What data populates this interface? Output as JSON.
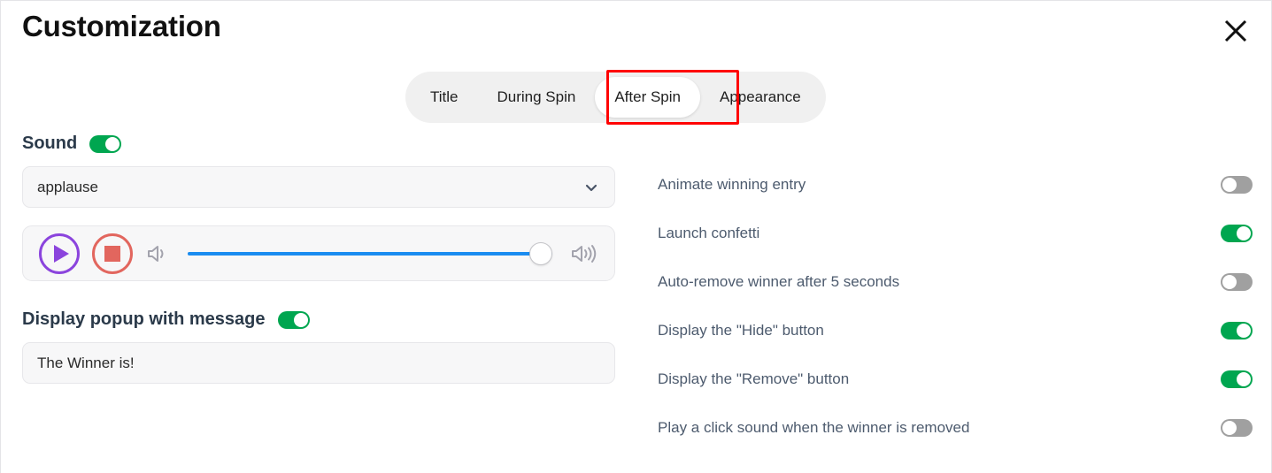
{
  "dialog": {
    "title": "Customization",
    "close_icon": "close-icon"
  },
  "tabs": {
    "items": [
      {
        "label": "Title",
        "active": false
      },
      {
        "label": "During Spin",
        "active": false
      },
      {
        "label": "After Spin",
        "active": true
      },
      {
        "label": "Appearance",
        "active": false
      }
    ],
    "highlight_color": "#ff0000",
    "active_index": 2
  },
  "sound": {
    "label": "Sound",
    "enabled": true,
    "select_value": "applause",
    "chevron_icon": "chevron-down-icon",
    "player": {
      "play_icon": "play-icon",
      "stop_icon": "stop-icon",
      "volume_low_icon": "volume-low-icon",
      "volume_high_icon": "volume-high-icon",
      "volume_percent": 100
    }
  },
  "popup": {
    "label": "Display popup with message",
    "enabled": true,
    "message": "The Winner is!"
  },
  "options": [
    {
      "label": "Animate winning entry",
      "on": false
    },
    {
      "label": "Launch confetti",
      "on": true
    },
    {
      "label": "Auto-remove winner after 5 seconds",
      "on": false
    },
    {
      "label": "Display the \"Hide\" button",
      "on": true
    },
    {
      "label": "Display the \"Remove\" button",
      "on": true
    },
    {
      "label": "Play a click sound when the winner is removed",
      "on": false
    }
  ],
  "colors": {
    "toggle_on": "#00a650",
    "toggle_off": "#a0a0a0",
    "slider": "#1a8cf0",
    "play": "#8b44dd",
    "stop": "#e2665e",
    "highlight": "#ff0000"
  }
}
